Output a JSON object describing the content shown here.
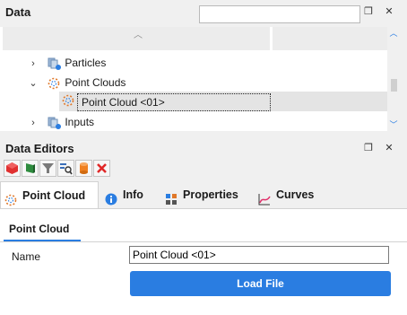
{
  "data_panel": {
    "title": "Data",
    "search_value": "",
    "tree": [
      {
        "label": "Particles",
        "expanded": false,
        "icon": "particles-icon"
      },
      {
        "label": "Point Clouds",
        "expanded": true,
        "icon": "point-cloud-icon"
      },
      {
        "label": "Point Cloud <01>",
        "selected": true,
        "icon": "point-cloud-icon"
      },
      {
        "label": "Inputs",
        "expanded": false,
        "icon": "inputs-icon"
      }
    ]
  },
  "editors_panel": {
    "title": "Data Editors",
    "toolbar": [
      {
        "icon": "red-cube-icon",
        "color": "#e03030"
      },
      {
        "icon": "green-flag-icon",
        "color": "#2e8b3e"
      },
      {
        "icon": "filter-icon",
        "color": "#7a7a7a"
      },
      {
        "icon": "search-list-icon",
        "color": "#3b6fb8"
      },
      {
        "icon": "orange-cylinder-icon",
        "color": "#f08020"
      },
      {
        "icon": "delete-icon",
        "color": "#e02828"
      }
    ],
    "tabs": [
      {
        "label": "Point Cloud",
        "active": true
      },
      {
        "label": "Info",
        "active": false
      },
      {
        "label": "Properties",
        "active": false
      },
      {
        "label": "Curves",
        "active": false
      }
    ],
    "subtab": "Point Cloud",
    "name_label": "Name",
    "name_value": "Point Cloud <01>",
    "load_button": "Load File"
  },
  "colors": {
    "accent": "#2a7de1",
    "delete": "#e02828"
  }
}
